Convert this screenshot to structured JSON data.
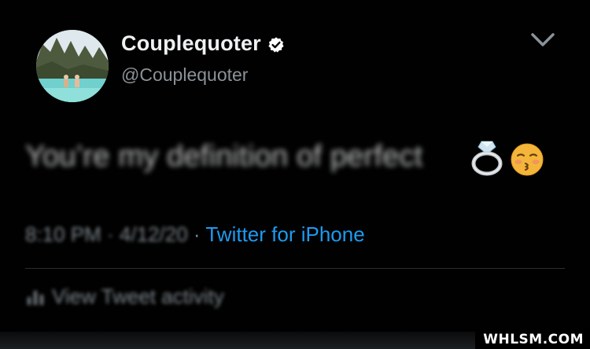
{
  "tweet": {
    "display_name": "Couplequoter",
    "handle": "@Couplequoter",
    "verified": true,
    "text": "You’re my definition of perfect",
    "emojis": [
      "ring-emoji",
      "kissing-face-emoji"
    ],
    "timestamp": "8:10 PM · 4/12/20",
    "separator": "·",
    "source": "Twitter for iPhone",
    "activity_label": "View Tweet activity"
  },
  "icons": {
    "menu": "chevron-down-icon",
    "verified": "verified-badge-icon",
    "activity": "bar-chart-icon"
  },
  "watermark": "WHLSM.COM",
  "colors": {
    "background": "#000000",
    "link": "#1d9bf0",
    "verified": "#ffffff",
    "muted": "#7e868c"
  }
}
